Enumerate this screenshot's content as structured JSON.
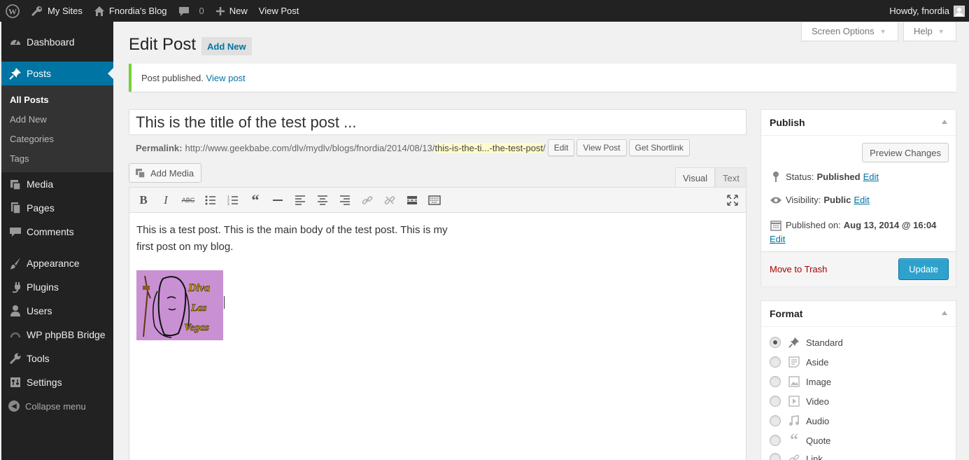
{
  "adminbar": {
    "my_sites": "My Sites",
    "site_name": "Fnordia's Blog",
    "comments_count": "0",
    "new_label": "New",
    "view_post": "View Post",
    "howdy": "Howdy, fnordia"
  },
  "screen_options": {
    "screen_options_label": "Screen Options",
    "help_label": "Help"
  },
  "sidebar": {
    "items": [
      {
        "label": "Dashboard",
        "icon": "dashboard-icon"
      },
      {
        "label": "Posts",
        "icon": "pin-icon"
      },
      {
        "label": "Media",
        "icon": "media-icon"
      },
      {
        "label": "Pages",
        "icon": "pages-icon"
      },
      {
        "label": "Comments",
        "icon": "comments-icon"
      },
      {
        "label": "Appearance",
        "icon": "brush-icon"
      },
      {
        "label": "Plugins",
        "icon": "plug-icon"
      },
      {
        "label": "Users",
        "icon": "users-icon"
      },
      {
        "label": "WP phpBB Bridge",
        "icon": "bridge-icon"
      },
      {
        "label": "Tools",
        "icon": "wrench-icon"
      },
      {
        "label": "Settings",
        "icon": "settings-icon"
      }
    ],
    "submenu": [
      "All Posts",
      "Add New",
      "Categories",
      "Tags"
    ],
    "collapse": "Collapse menu"
  },
  "heading": {
    "title": "Edit Post",
    "add_new": "Add New"
  },
  "notice": {
    "text": "Post published.",
    "link": "View post"
  },
  "post": {
    "title": "This is the title of the test post ...",
    "permalink_label": "Permalink:",
    "permalink_base": "http://www.geekbabe.com/dlv/mydlv/blogs/fnordia/2014/08/13/",
    "permalink_slug": "this-is-the-ti...-the-test-post",
    "permalink_end": "/",
    "edit_btn": "Edit",
    "view_post_btn": "View Post",
    "shortlink_btn": "Get Shortlink",
    "body_line1": "This is a test post. This is the main body of the test post. This is my first post on my blog."
  },
  "editor": {
    "add_media": "Add Media",
    "tab_visual": "Visual",
    "tab_text": "Text",
    "image_text": [
      "Diva",
      "Las",
      "Vegas"
    ]
  },
  "publish": {
    "title": "Publish",
    "preview": "Preview Changes",
    "status_label": "Status:",
    "status_value": "Published",
    "visibility_label": "Visibility:",
    "visibility_value": "Public",
    "published_label": "Published on:",
    "published_value": "Aug 13, 2014 @ 16:04",
    "edit": "Edit",
    "trash": "Move to Trash",
    "update": "Update"
  },
  "format": {
    "title": "Format",
    "options": [
      "Standard",
      "Aside",
      "Image",
      "Video",
      "Audio",
      "Quote",
      "Link"
    ],
    "selected": "Standard"
  }
}
